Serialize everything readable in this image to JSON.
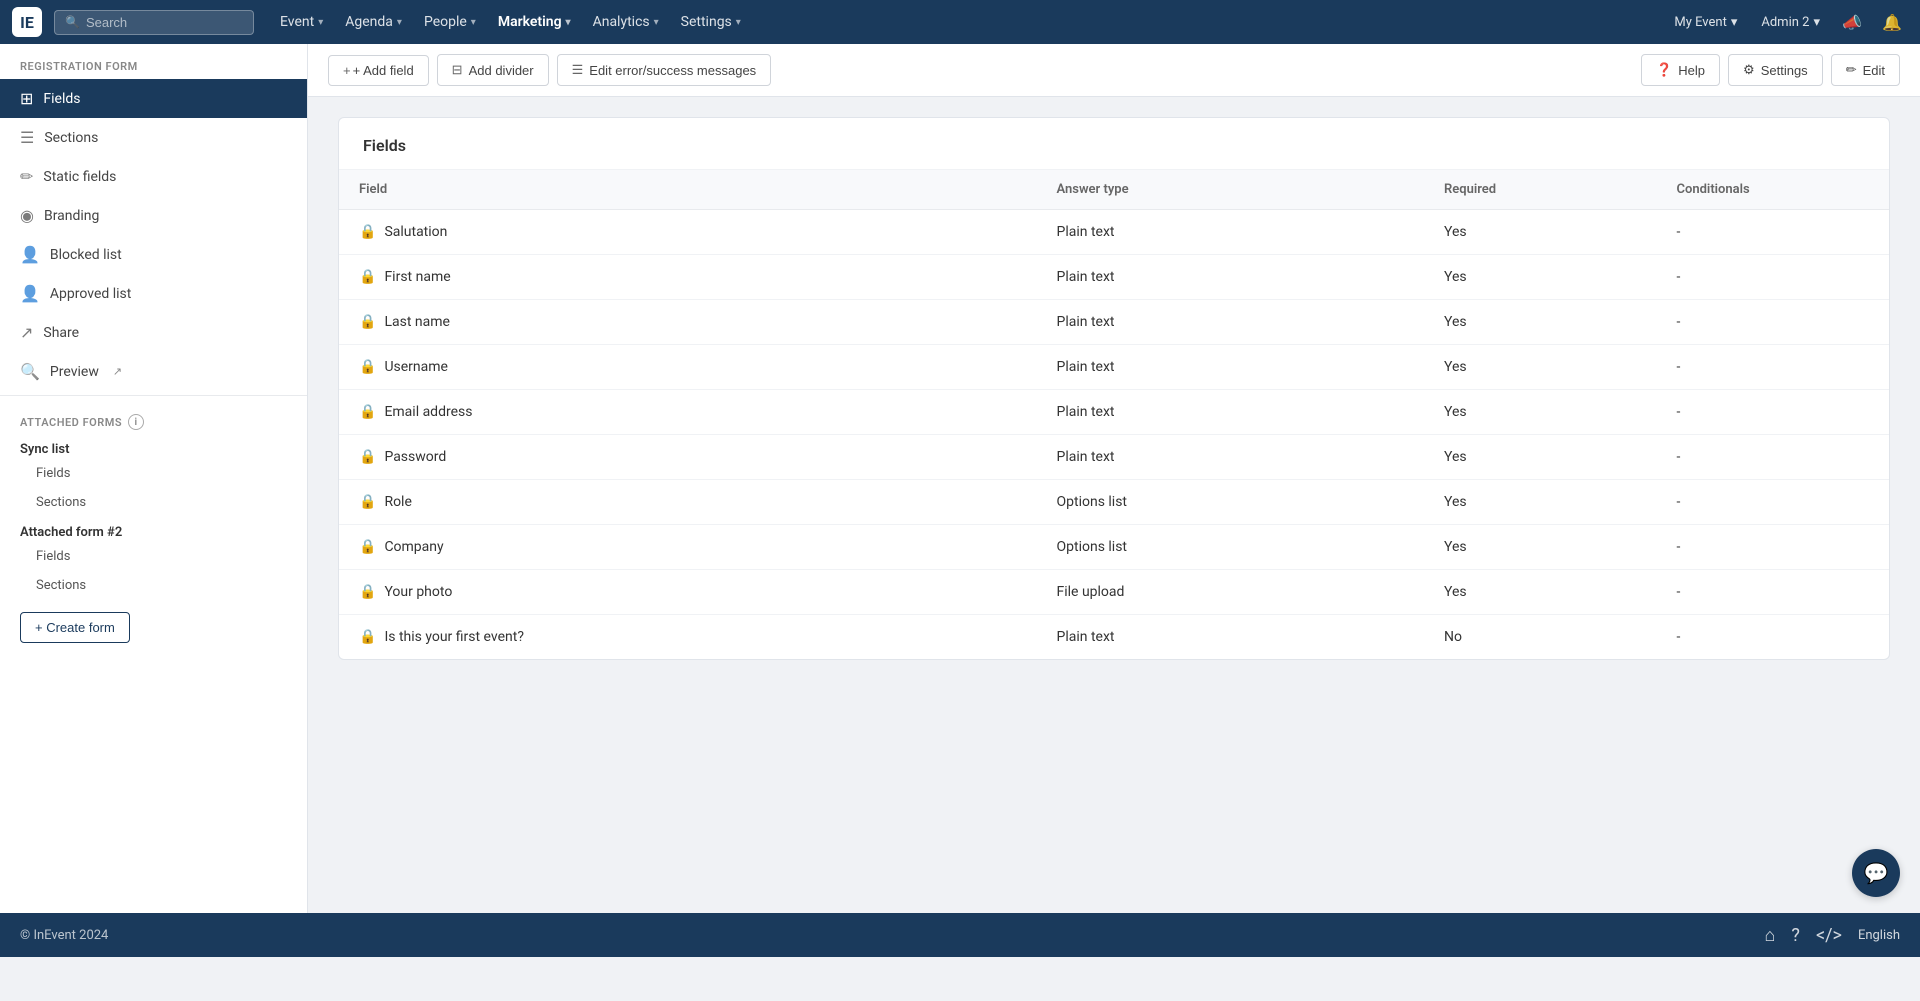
{
  "app": {
    "logo": "IE",
    "copyright": "© InEvent 2024"
  },
  "topnav": {
    "search_placeholder": "Search",
    "items": [
      {
        "label": "Event",
        "has_dropdown": true
      },
      {
        "label": "Agenda",
        "has_dropdown": true
      },
      {
        "label": "People",
        "has_dropdown": true
      },
      {
        "label": "Marketing",
        "has_dropdown": true
      },
      {
        "label": "Analytics",
        "has_dropdown": true
      },
      {
        "label": "Settings",
        "has_dropdown": true
      }
    ],
    "right": {
      "my_event": "My Event",
      "admin": "Admin 2"
    }
  },
  "toolbar": {
    "add_field": "+ Add field",
    "add_divider": "Add divider",
    "edit_messages": "Edit error/success messages",
    "help": "Help",
    "settings": "Settings",
    "edit": "Edit"
  },
  "sidebar": {
    "registration_form_label": "REGISTRATION FORM",
    "nav_items": [
      {
        "id": "fields",
        "label": "Fields",
        "icon": "▦",
        "active": true
      },
      {
        "id": "sections",
        "label": "Sections",
        "icon": "☰"
      },
      {
        "id": "static-fields",
        "label": "Static fields",
        "icon": "✏️"
      },
      {
        "id": "branding",
        "label": "Branding",
        "icon": "🎨"
      },
      {
        "id": "blocked-list",
        "label": "Blocked list",
        "icon": "👤"
      },
      {
        "id": "approved-list",
        "label": "Approved list",
        "icon": "👤"
      },
      {
        "id": "share",
        "label": "Share",
        "icon": "↗"
      },
      {
        "id": "preview",
        "label": "Preview",
        "icon": "🔍"
      }
    ],
    "attached_forms_label": "ATTACHED FORMS",
    "attached_groups": [
      {
        "title": "Sync list",
        "items": [
          "Fields",
          "Sections"
        ]
      },
      {
        "title": "Attached form #2",
        "items": [
          "Fields",
          "Sections"
        ]
      }
    ],
    "create_form_btn": "+ Create form"
  },
  "fields_table": {
    "title": "Fields",
    "columns": {
      "field": "Field",
      "answer_type": "Answer type",
      "required": "Required",
      "conditionals": "Conditionals"
    },
    "rows": [
      {
        "field": "Salutation",
        "answer_type": "Plain text",
        "required": "Yes",
        "conditionals": "-",
        "locked": true
      },
      {
        "field": "First name",
        "answer_type": "Plain text",
        "required": "Yes",
        "conditionals": "-",
        "locked": true
      },
      {
        "field": "Last name",
        "answer_type": "Plain text",
        "required": "Yes",
        "conditionals": "-",
        "locked": true
      },
      {
        "field": "Username",
        "answer_type": "Plain text",
        "required": "Yes",
        "conditionals": "-",
        "locked": true
      },
      {
        "field": "Email address",
        "answer_type": "Plain text",
        "required": "Yes",
        "conditionals": "-",
        "locked": true
      },
      {
        "field": "Password",
        "answer_type": "Plain text",
        "required": "Yes",
        "conditionals": "-",
        "locked": true
      },
      {
        "field": "Role",
        "answer_type": "Options list",
        "required": "Yes",
        "conditionals": "-",
        "locked": true
      },
      {
        "field": "Company",
        "answer_type": "Options list",
        "required": "Yes",
        "conditionals": "-",
        "locked": true
      },
      {
        "field": "Your photo",
        "answer_type": "File upload",
        "required": "Yes",
        "conditionals": "-",
        "locked": true
      },
      {
        "field": "Is this your first event?",
        "answer_type": "Plain text",
        "required": "No",
        "conditionals": "-",
        "locked": true
      }
    ]
  },
  "bottom_bar": {
    "copyright": "© InEvent 2024",
    "language": "English"
  }
}
